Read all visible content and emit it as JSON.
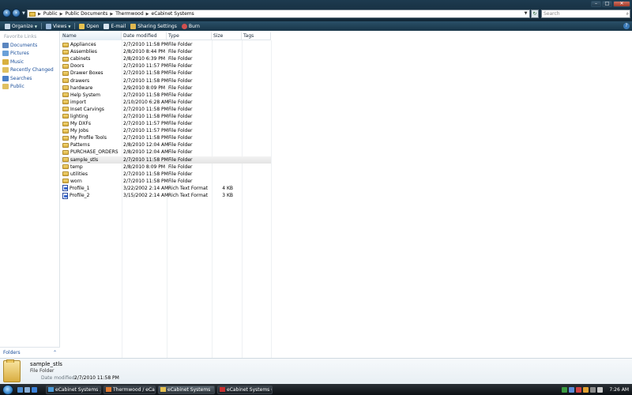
{
  "address": {
    "crumbs": [
      "Public",
      "Public Documents",
      "Thermwood",
      "eCabinet Systems"
    ]
  },
  "search": {
    "placeholder": "Search"
  },
  "window_buttons": {
    "minimize": "–",
    "maximize": "□",
    "close": "✕"
  },
  "toolbar": {
    "organize": "Organize",
    "views": "Views",
    "open": "Open",
    "email": "E-mail",
    "sharing": "Sharing Settings",
    "burn": "Burn",
    "help": "?"
  },
  "nav": {
    "title": "Favorite Links",
    "items": [
      {
        "label": "Documents",
        "color": "#5a86c0"
      },
      {
        "label": "Pictures",
        "color": "#6aa0d8"
      },
      {
        "label": "Music",
        "color": "#d8b040"
      },
      {
        "label": "Recently Changed",
        "color": "#e0c060"
      },
      {
        "label": "Searches",
        "color": "#4a80c8"
      },
      {
        "label": "Public",
        "color": "#e0c060"
      }
    ],
    "folders_label": "Folders"
  },
  "columns": {
    "name": "Name",
    "date": "Date modified",
    "type": "Type",
    "size": "Size",
    "tags": "Tags"
  },
  "files": [
    {
      "name": "Appliances",
      "date": "2/7/2010 11:58 PM",
      "type": "File Folder",
      "size": "",
      "kind": "folder"
    },
    {
      "name": "Assemblies",
      "date": "2/8/2010 8:44 PM",
      "type": "File Folder",
      "size": "",
      "kind": "folder"
    },
    {
      "name": "cabinets",
      "date": "2/8/2010 6:39 PM",
      "type": "File Folder",
      "size": "",
      "kind": "folder"
    },
    {
      "name": "Doors",
      "date": "2/7/2010 11:57 PM",
      "type": "File Folder",
      "size": "",
      "kind": "folder"
    },
    {
      "name": "Drawer Boxes",
      "date": "2/7/2010 11:58 PM",
      "type": "File Folder",
      "size": "",
      "kind": "folder"
    },
    {
      "name": "drawers",
      "date": "2/7/2010 11:58 PM",
      "type": "File Folder",
      "size": "",
      "kind": "folder"
    },
    {
      "name": "hardware",
      "date": "2/9/2010 8:09 PM",
      "type": "File Folder",
      "size": "",
      "kind": "folder"
    },
    {
      "name": "Help System",
      "date": "2/7/2010 11:58 PM",
      "type": "File Folder",
      "size": "",
      "kind": "folder"
    },
    {
      "name": "import",
      "date": "2/10/2010 6:28 AM",
      "type": "File Folder",
      "size": "",
      "kind": "folder"
    },
    {
      "name": "Inset Carvings",
      "date": "2/7/2010 11:58 PM",
      "type": "File Folder",
      "size": "",
      "kind": "folder"
    },
    {
      "name": "lighting",
      "date": "2/7/2010 11:58 PM",
      "type": "File Folder",
      "size": "",
      "kind": "folder"
    },
    {
      "name": "My DXFs",
      "date": "2/7/2010 11:57 PM",
      "type": "File Folder",
      "size": "",
      "kind": "folder"
    },
    {
      "name": "My Jobs",
      "date": "2/7/2010 11:57 PM",
      "type": "File Folder",
      "size": "",
      "kind": "folder"
    },
    {
      "name": "My Profile Tools",
      "date": "2/7/2010 11:58 PM",
      "type": "File Folder",
      "size": "",
      "kind": "folder"
    },
    {
      "name": "Patterns",
      "date": "2/8/2010 12:04 AM",
      "type": "File Folder",
      "size": "",
      "kind": "folder"
    },
    {
      "name": "PURCHASE_ORDERS",
      "date": "2/8/2010 12:04 AM",
      "type": "File Folder",
      "size": "",
      "kind": "folder"
    },
    {
      "name": "sample_stls",
      "date": "2/7/2010 11:58 PM",
      "type": "File Folder",
      "size": "",
      "kind": "folder",
      "selected": true
    },
    {
      "name": "temp",
      "date": "2/8/2010 8:09 PM",
      "type": "File Folder",
      "size": "",
      "kind": "folder"
    },
    {
      "name": "utilities",
      "date": "2/7/2010 11:58 PM",
      "type": "File Folder",
      "size": "",
      "kind": "folder"
    },
    {
      "name": "worn",
      "date": "2/7/2010 11:58 PM",
      "type": "File Folder",
      "size": "",
      "kind": "folder"
    },
    {
      "name": "Profile_1",
      "date": "3/22/2002 2:14 AM",
      "type": "Rich Text Format",
      "size": "4 KB",
      "kind": "rtf"
    },
    {
      "name": "Profile_2",
      "date": "3/15/2002 2:14 AM",
      "type": "Rich Text Format",
      "size": "3 KB",
      "kind": "rtf"
    }
  ],
  "details": {
    "name": "sample_stls",
    "type": "File Folder",
    "date_label": "Date modified:",
    "date_value": "2/7/2010 11:58 PM"
  },
  "taskbar": {
    "tasks": [
      {
        "label": "eCabinet Systems 3...",
        "icon_color": "#4a9ad8",
        "width": 70
      },
      {
        "label": "Thermwood / eCabi...",
        "icon_color": "#e07a30",
        "width": 66
      },
      {
        "label": "eCabinet Systems",
        "icon_color": "#e6c150",
        "width": 72,
        "active": true
      },
      {
        "label": "eCabinet Systems 6...",
        "icon_color": "#c83030",
        "width": 70
      }
    ],
    "clock": "7:26 AM"
  }
}
